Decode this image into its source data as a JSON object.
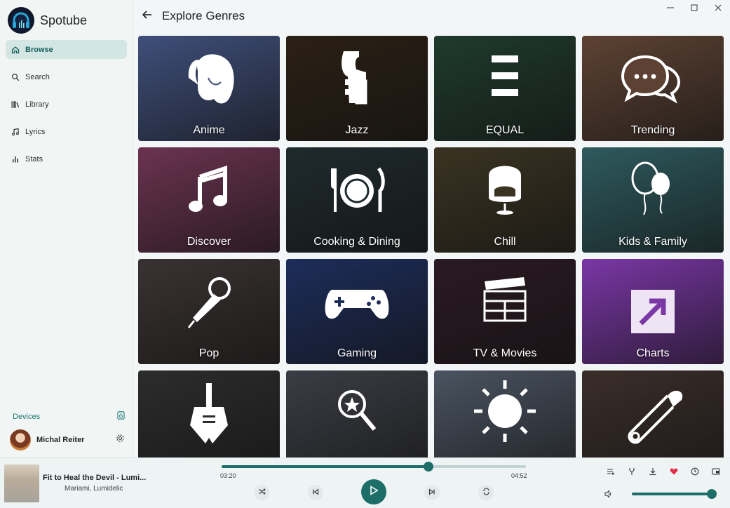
{
  "app": {
    "name": "Spotube"
  },
  "sidebar": {
    "items": [
      {
        "label": "Browse",
        "icon": "home-icon",
        "active": true
      },
      {
        "label": "Search",
        "icon": "search-icon"
      },
      {
        "label": "Library",
        "icon": "library-icon"
      },
      {
        "label": "Lyrics",
        "icon": "music-note-icon"
      },
      {
        "label": "Stats",
        "icon": "bar-chart-icon"
      }
    ],
    "devices_label": "Devices",
    "user_name": "Michal Reiter"
  },
  "header": {
    "title": "Explore Genres"
  },
  "genres": [
    {
      "label": "Anime",
      "icon": "anime-girl-icon",
      "bg": "#3f4f7a"
    },
    {
      "label": "Jazz",
      "icon": "saxophone-icon",
      "bg": "#2b2015"
    },
    {
      "label": "EQUAL",
      "icon": "equal-bars-icon",
      "bg": "#1f3a2d"
    },
    {
      "label": "Trending",
      "icon": "chat-bubbles-icon",
      "bg": "#5d4233"
    },
    {
      "label": "Discover",
      "icon": "music-note-icon",
      "bg": "#6b3350"
    },
    {
      "label": "Cooking & Dining",
      "icon": "plate-cutlery-icon",
      "bg": "#1f2a2d"
    },
    {
      "label": "Chill",
      "icon": "egg-chair-icon",
      "bg": "#3a3322"
    },
    {
      "label": "Kids & Family",
      "icon": "balloons-icon",
      "bg": "#2e5a5e"
    },
    {
      "label": "Pop",
      "icon": "microphone-icon",
      "bg": "#3a3232"
    },
    {
      "label": "Gaming",
      "icon": "gamepad-icon",
      "bg": "#1d2d5a"
    },
    {
      "label": "TV & Movies",
      "icon": "clapperboard-icon",
      "bg": "#2a1a22"
    },
    {
      "label": "Charts",
      "icon": "arrow-up-right-icon",
      "bg": "#7a37a5"
    },
    {
      "label": "",
      "icon": "guitar-icon",
      "bg": "#2c2c2c"
    },
    {
      "label": "",
      "icon": "search-star-icon",
      "bg": "#3b3d44"
    },
    {
      "label": "",
      "icon": "sun-icon",
      "bg": "#4a5360"
    },
    {
      "label": "",
      "icon": "safety-pin-icon",
      "bg": "#3a2e2a"
    }
  ],
  "player": {
    "track_title": "Fit to Heal the Devil - Lumi...",
    "track_artist": "Mariami, Lumidelic",
    "time_current": "03:20",
    "time_total": "04:52",
    "progress": 0.68,
    "volume": 0.9
  },
  "colors": {
    "accent": "#1d6e69",
    "liked": "#e0314b"
  }
}
